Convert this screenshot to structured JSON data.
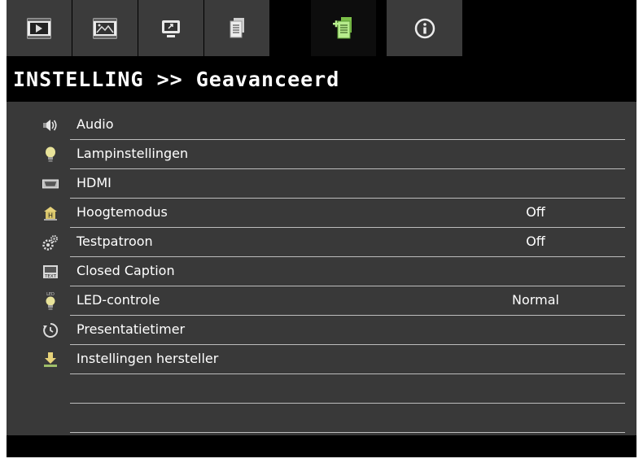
{
  "colors": {
    "tab_bg": "#3b3b3b",
    "tab_active_bg": "#0d0d0d",
    "panel_bg": "#393939",
    "accent_icon": "#9ddc6a"
  },
  "tabs": [
    {
      "icon": "video-play-icon"
    },
    {
      "icon": "image-settings-icon"
    },
    {
      "icon": "display-icon"
    },
    {
      "icon": "document-setup-icon"
    },
    {
      "icon": "advanced-setup-icon",
      "active": true
    },
    {
      "icon": "info-icon"
    }
  ],
  "header": {
    "title": "INSTELLING >> Geavanceerd"
  },
  "menu": {
    "items": [
      {
        "icon": "speaker-icon",
        "label": "Audio",
        "value": ""
      },
      {
        "icon": "lamp-icon",
        "label": "Lampinstellingen",
        "value": ""
      },
      {
        "icon": "hdmi-icon",
        "label": "HDMI",
        "value": ""
      },
      {
        "icon": "altitude-icon",
        "label": "Hoogtemodus",
        "value": "Off"
      },
      {
        "icon": "gears-icon",
        "label": "Testpatroon",
        "value": "Off"
      },
      {
        "icon": "caption-icon",
        "label": "Closed Caption",
        "value": ""
      },
      {
        "icon": "led-icon",
        "label": "LED-controle",
        "value": "Normal"
      },
      {
        "icon": "timer-icon",
        "label": "Presentatietimer",
        "value": ""
      },
      {
        "icon": "reset-icon",
        "label": "Instellingen hersteller",
        "value": ""
      },
      {
        "icon": "",
        "label": "",
        "value": ""
      },
      {
        "icon": "",
        "label": "",
        "value": ""
      }
    ]
  }
}
